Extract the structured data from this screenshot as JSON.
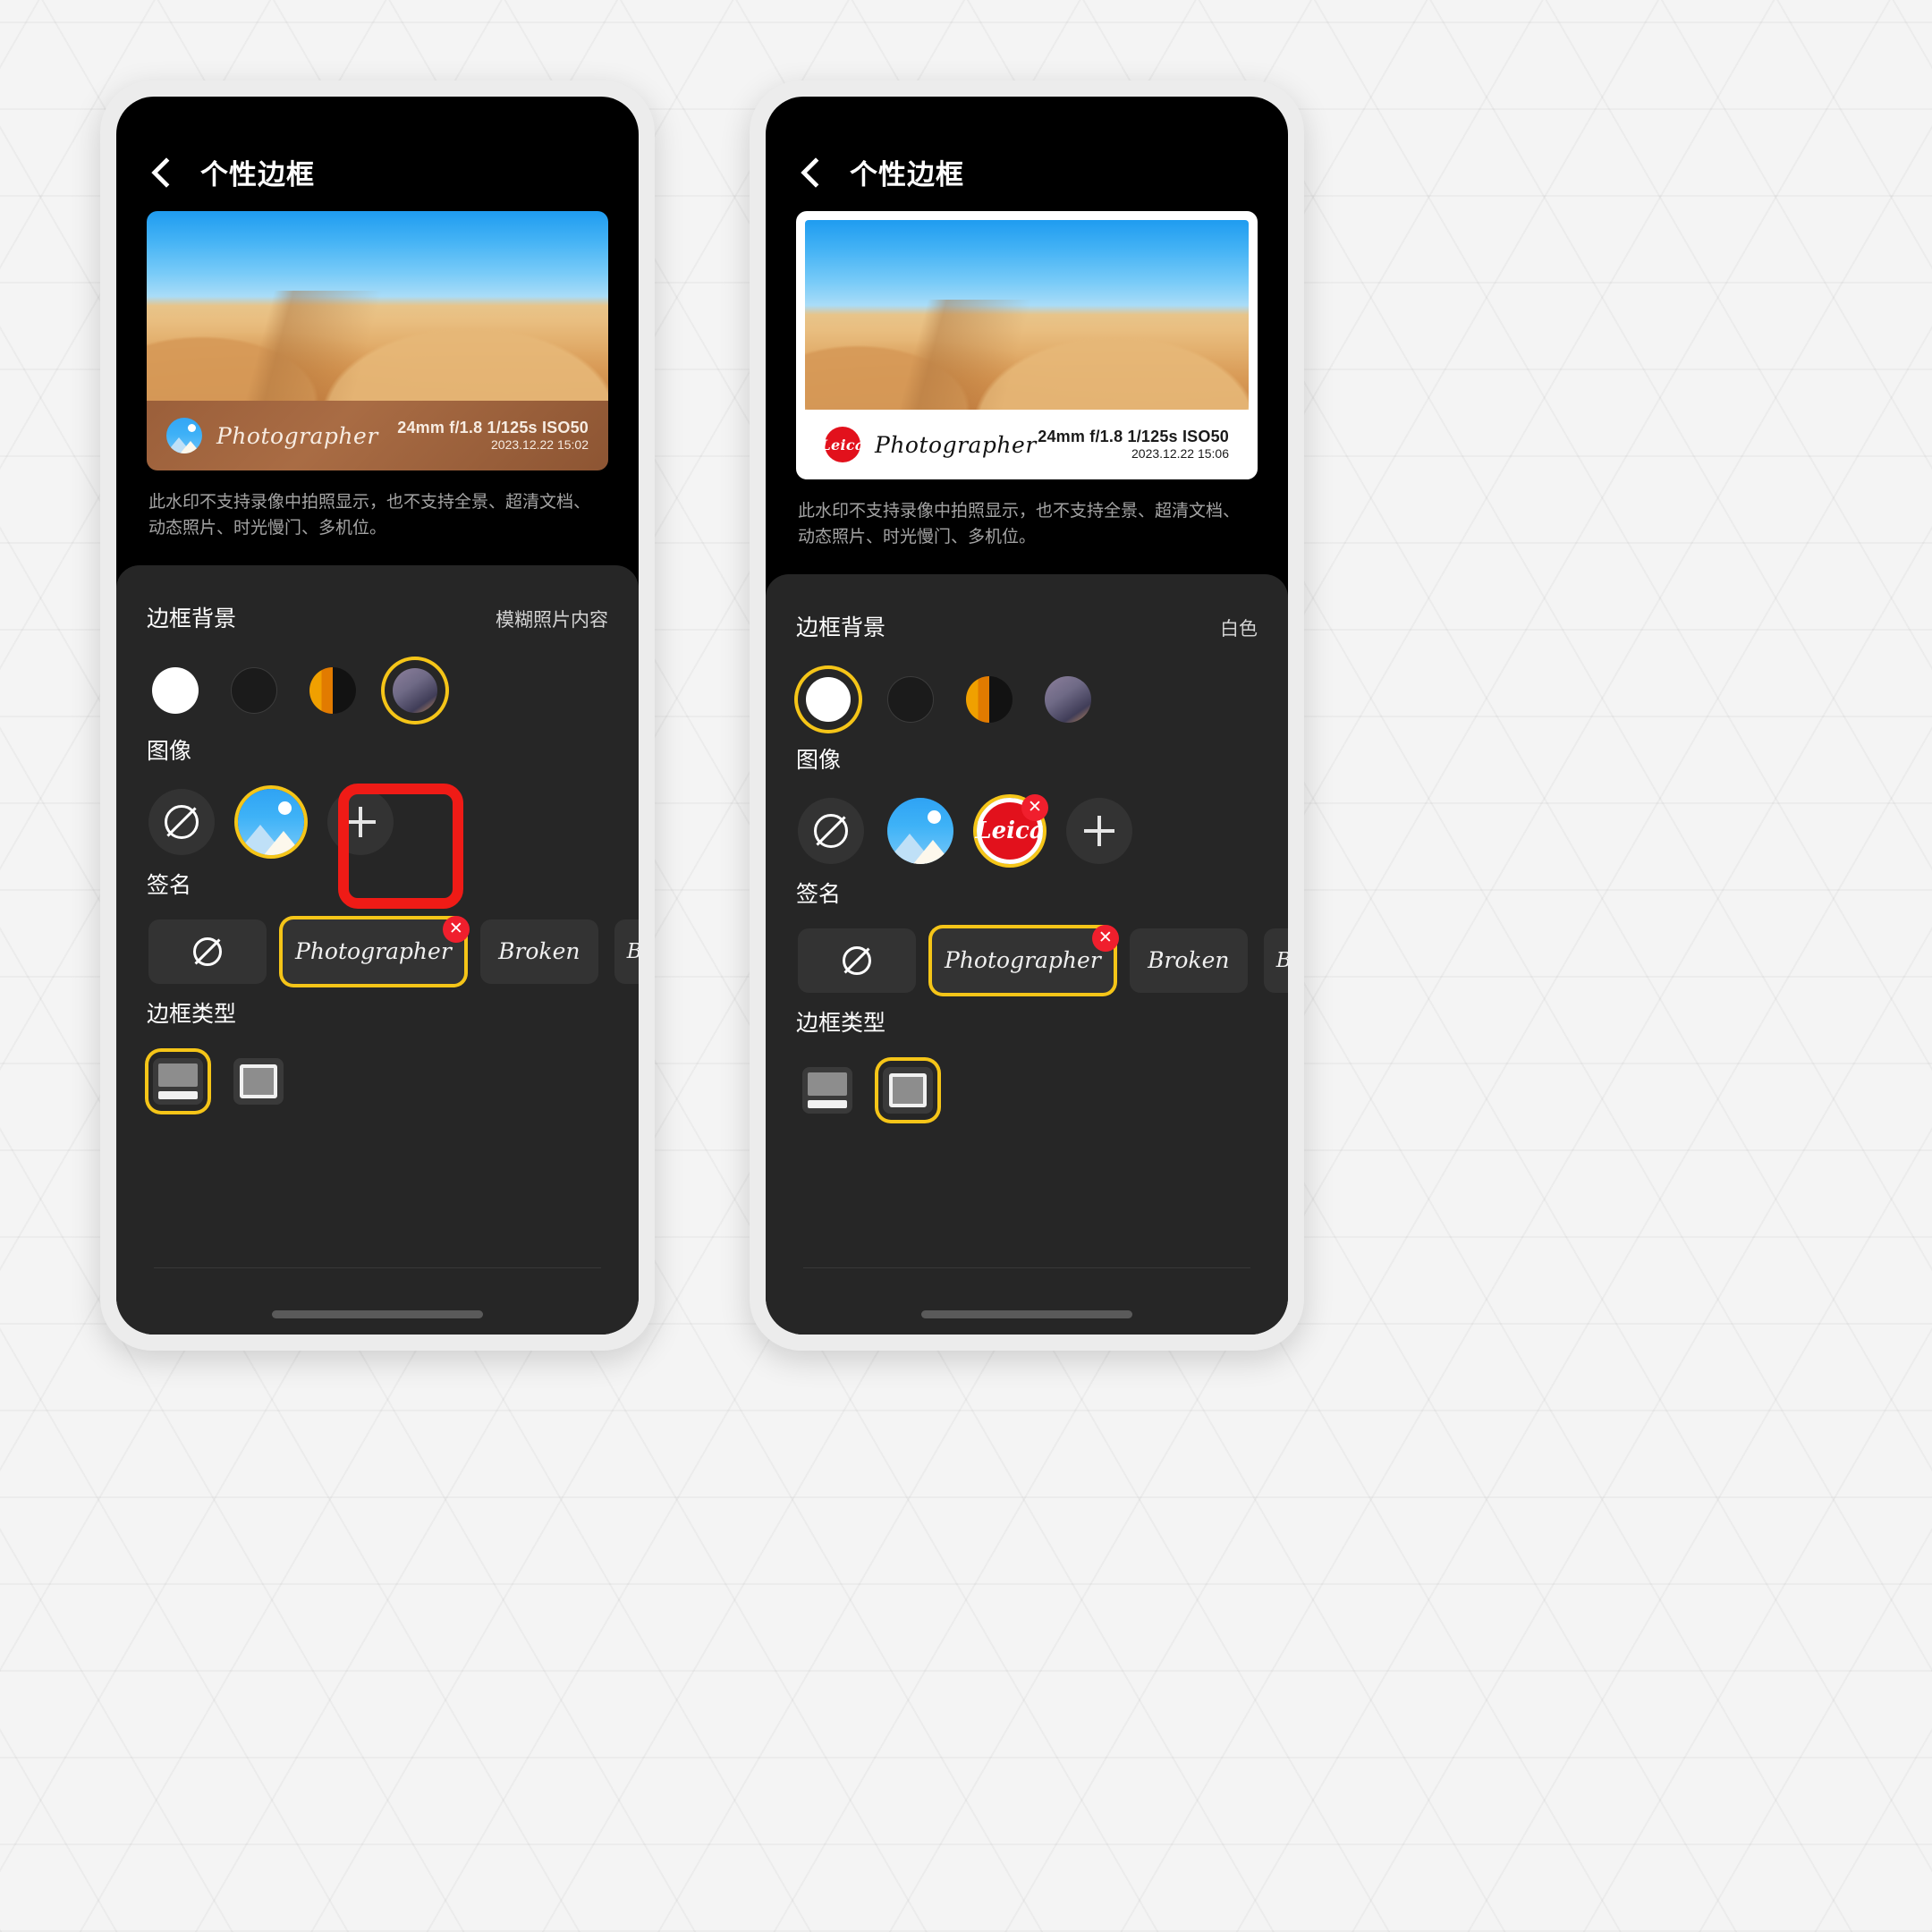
{
  "background": {
    "color": "#f2f2f2"
  },
  "accent": {
    "selected_ring": "#f5c518",
    "callout": "#ef1b16",
    "delete_badge": "#f01f2d",
    "leica_red": "#e2111c"
  },
  "panels": [
    {
      "id": "left",
      "appbar": {
        "title": "个性边框",
        "back_icon": "chevron-left-icon"
      },
      "preview": {
        "frame_style": "blur",
        "signature": "Photographer",
        "logo": "gallery-icon",
        "exif": "24mm f/1.8 1/125s ISO50",
        "date": "2023.12.22 15:02"
      },
      "hint": "此水印不支持录像中拍照显示，也不支持全景、超清文档、动态照片、时光慢门、多机位。",
      "sections": {
        "background": {
          "title": "边框背景",
          "value": "模糊照片内容",
          "options": [
            {
              "name": "white",
              "label": "白色",
              "selected": false
            },
            {
              "name": "black",
              "label": "黑色",
              "selected": false
            },
            {
              "name": "gradient",
              "label": "渐变",
              "selected": false
            },
            {
              "name": "blurimg",
              "label": "模糊照片内容",
              "selected": true
            }
          ]
        },
        "image": {
          "title": "图像",
          "options": [
            {
              "name": "none",
              "icon": "no-entry-icon",
              "selected": false,
              "removable": false
            },
            {
              "name": "gallery",
              "icon": "gallery-icon",
              "selected": true,
              "removable": false
            },
            {
              "name": "add",
              "icon": "plus-icon",
              "selected": false,
              "removable": false,
              "highlighted": true
            }
          ]
        },
        "signature": {
          "title": "签名",
          "options": [
            {
              "name": "none",
              "label": "",
              "icon": "no-entry-icon",
              "selected": false,
              "removable": false
            },
            {
              "name": "photographer",
              "label": "Photographer",
              "selected": true,
              "removable": true
            },
            {
              "name": "broken",
              "label": "Broken",
              "selected": false,
              "removable": false
            },
            {
              "name": "broken-caps",
              "label": "BROKEN",
              "selected": false,
              "removable": false
            },
            {
              "name": "add",
              "label": "",
              "icon": "plus-icon",
              "selected": false,
              "removable": false
            }
          ]
        },
        "frame_type": {
          "title": "边框类型",
          "options": [
            {
              "name": "bottom-bar",
              "selected": true
            },
            {
              "name": "all-around",
              "selected": false
            }
          ]
        }
      }
    },
    {
      "id": "right",
      "appbar": {
        "title": "个性边框",
        "back_icon": "chevron-left-icon"
      },
      "preview": {
        "frame_style": "white",
        "signature": "Photographer",
        "logo": "leica-icon",
        "logo_text": "Leica",
        "exif": "24mm f/1.8 1/125s ISO50",
        "date": "2023.12.22 15:06"
      },
      "hint": "此水印不支持录像中拍照显示，也不支持全景、超清文档、动态照片、时光慢门、多机位。",
      "sections": {
        "background": {
          "title": "边框背景",
          "value": "白色",
          "options": [
            {
              "name": "white",
              "label": "白色",
              "selected": true
            },
            {
              "name": "black",
              "label": "黑色",
              "selected": false
            },
            {
              "name": "gradient",
              "label": "渐变",
              "selected": false
            },
            {
              "name": "blurimg",
              "label": "模糊照片内容",
              "selected": false
            }
          ]
        },
        "image": {
          "title": "图像",
          "options": [
            {
              "name": "none",
              "icon": "no-entry-icon",
              "selected": false,
              "removable": false
            },
            {
              "name": "gallery",
              "icon": "gallery-icon",
              "selected": false,
              "removable": false
            },
            {
              "name": "leica",
              "icon": "leica-icon",
              "label": "Leica",
              "selected": true,
              "removable": true
            },
            {
              "name": "add",
              "icon": "plus-icon",
              "selected": false,
              "removable": false
            }
          ]
        },
        "signature": {
          "title": "签名",
          "options": [
            {
              "name": "none",
              "label": "",
              "icon": "no-entry-icon",
              "selected": false,
              "removable": false
            },
            {
              "name": "photographer",
              "label": "Photographer",
              "selected": true,
              "removable": true
            },
            {
              "name": "broken",
              "label": "Broken",
              "selected": false,
              "removable": false
            },
            {
              "name": "broken-caps",
              "label": "BROKEN",
              "selected": false,
              "removable": false
            },
            {
              "name": "add",
              "label": "",
              "icon": "plus-icon",
              "selected": false,
              "removable": false
            }
          ]
        },
        "frame_type": {
          "title": "边框类型",
          "options": [
            {
              "name": "bottom-bar",
              "selected": false
            },
            {
              "name": "all-around",
              "selected": true
            }
          ]
        }
      }
    }
  ],
  "badge_glyph": "✕"
}
